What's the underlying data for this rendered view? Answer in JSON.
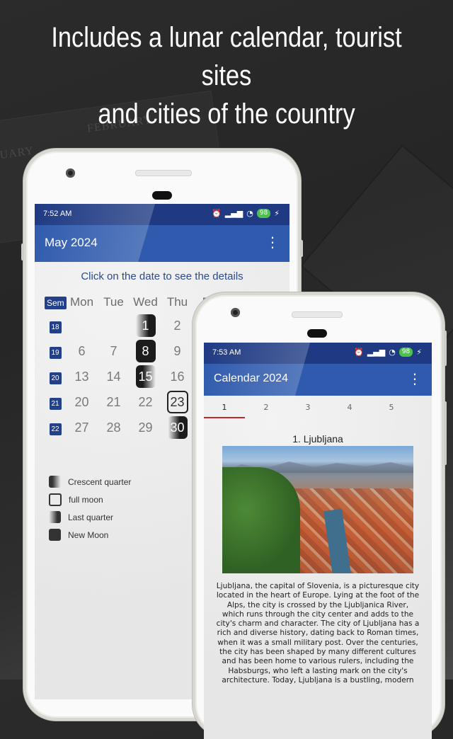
{
  "headline": {
    "line1": "Includes a lunar calendar, tourist sites",
    "line2": "and cities of the country"
  },
  "background": {
    "month1": "NUARY",
    "month2": "FEBRUARY"
  },
  "colors": {
    "status_bar": "#1f3a83",
    "app_bar": "#2f5aad",
    "week_badge": "#23408a",
    "tab_indicator": "#c0282d",
    "battery": "#4cc24c"
  },
  "phone1": {
    "status": {
      "time": "7:52 AM",
      "battery": "98"
    },
    "app_bar": {
      "title": "May 2024",
      "menu_icon": "more-vertical-icon"
    },
    "hint": "Click on the date to see the details",
    "calendar": {
      "week_header": "Sem",
      "day_headers": [
        "Mon",
        "Tue",
        "Wed",
        "Thu",
        "Fri"
      ],
      "weeks": [
        {
          "week": "18",
          "days": [
            "",
            "",
            "1",
            "2",
            ""
          ],
          "moon": [
            null,
            null,
            "first",
            null,
            null
          ]
        },
        {
          "week": "19",
          "days": [
            "6",
            "7",
            "8",
            "9",
            ""
          ],
          "moon": [
            null,
            null,
            "new",
            null,
            null
          ]
        },
        {
          "week": "20",
          "days": [
            "13",
            "14",
            "15",
            "16",
            ""
          ],
          "moon": [
            null,
            null,
            "last",
            null,
            null
          ]
        },
        {
          "week": "21",
          "days": [
            "20",
            "21",
            "22",
            "23",
            ""
          ],
          "moon": [
            null,
            null,
            null,
            "full",
            null
          ]
        },
        {
          "week": "22",
          "days": [
            "27",
            "28",
            "29",
            "30",
            ""
          ],
          "moon": [
            null,
            null,
            null,
            "first30",
            null
          ]
        }
      ]
    },
    "legend": [
      {
        "key": "first",
        "label": "Crescent quarter"
      },
      {
        "key": "full",
        "label": "full moon"
      },
      {
        "key": "last",
        "label": "Last quarter"
      },
      {
        "key": "new",
        "label": "New Moon"
      }
    ]
  },
  "phone2": {
    "status": {
      "time": "7:53 AM",
      "battery": "98"
    },
    "app_bar": {
      "title": "Calendar 2024",
      "menu_icon": "more-vertical-icon"
    },
    "tabs": [
      "1",
      "2",
      "3",
      "4",
      "5"
    ],
    "active_tab": 0,
    "city": {
      "title": "1. Ljubljana",
      "image_alt": "Aerial view of Ljubljana with castle hill, red roofs, river and Alps",
      "description": "Ljubljana, the capital of Slovenia, is a picturesque city located in the heart of Europe. Lying at the foot of the Alps, the city is crossed by the Ljubljanica River, which runs through the city center and adds to the city's charm and character. The city of Ljubljana has a rich and diverse history, dating back to Roman times, when it was a small military post. Over the centuries, the city has been shaped by many different cultures and has been home to various rulers, including the Habsburgs, who left a lasting mark on the city's architecture. Today, Ljubljana is a bustling, modern"
    }
  }
}
